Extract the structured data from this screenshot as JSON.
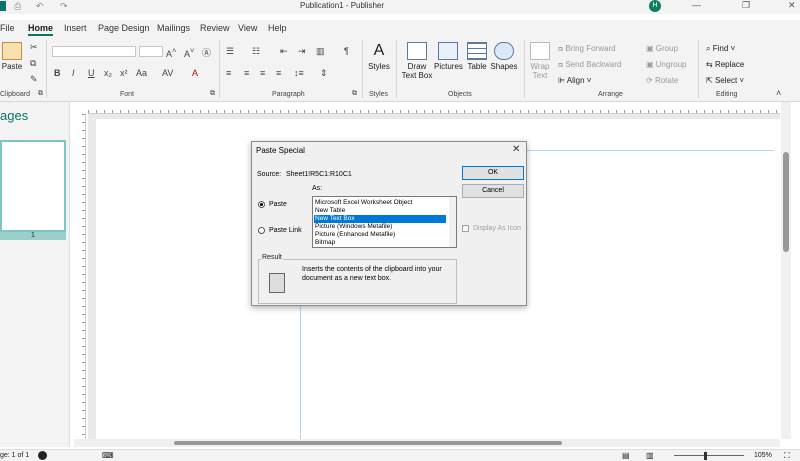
{
  "titlebar": {
    "title": "Publication1 - Publisher",
    "user_initial": "H"
  },
  "tabs": [
    "File",
    "Home",
    "Insert",
    "Page Design",
    "Mailings",
    "Review",
    "View",
    "Help"
  ],
  "ribbon": {
    "clipboard": {
      "paste": "Paste",
      "group": "Clipboard"
    },
    "font": {
      "group": "Font"
    },
    "paragraph": {
      "group": "Paragraph"
    },
    "styles": {
      "label": "Styles",
      "group": "Styles"
    },
    "objects": {
      "draw_text_box_1": "Draw",
      "draw_text_box_2": "Text Box",
      "pictures": "Pictures",
      "table": "Table",
      "shapes": "Shapes",
      "group": "Objects"
    },
    "arrange": {
      "wrap_1": "Wrap",
      "wrap_2": "Text",
      "bring_forward": "Bring Forward",
      "send_backward": "Send Backward",
      "align": "Align",
      "group_btn": "Group",
      "ungroup": "Ungroup",
      "rotate": "Rotate",
      "group": "Arrange"
    },
    "editing": {
      "find": "Find",
      "replace": "Replace",
      "select": "Select",
      "group": "Editing"
    }
  },
  "pages_pane": {
    "title": "ages",
    "page_number": "1"
  },
  "status": {
    "page": "ge: 1 of 1",
    "zoom": "105%"
  },
  "dialog": {
    "title": "Paste Special",
    "source_label": "Source:",
    "source_value": "Sheet1!R5C1:R10C1",
    "as_label": "As:",
    "radio_paste": "Paste",
    "radio_paste_link": "Paste Link",
    "options": [
      "Microsoft Excel Worksheet Object",
      "New Table",
      "New Text Box",
      "Picture (Windows Metafile)",
      "Picture (Enhanced Metafile)",
      "Bitmap"
    ],
    "selected_index": 2,
    "ok": "OK",
    "cancel": "Cancel",
    "display_as_icon": "Display As Icon",
    "result_label": "Result",
    "result_text_1": "Inserts the contents of the clipboard into your",
    "result_text_2": "document as a new text box."
  },
  "colors": {
    "accent": "#077568",
    "selection": "#0078d7",
    "highlight_box": "#23a23a"
  }
}
